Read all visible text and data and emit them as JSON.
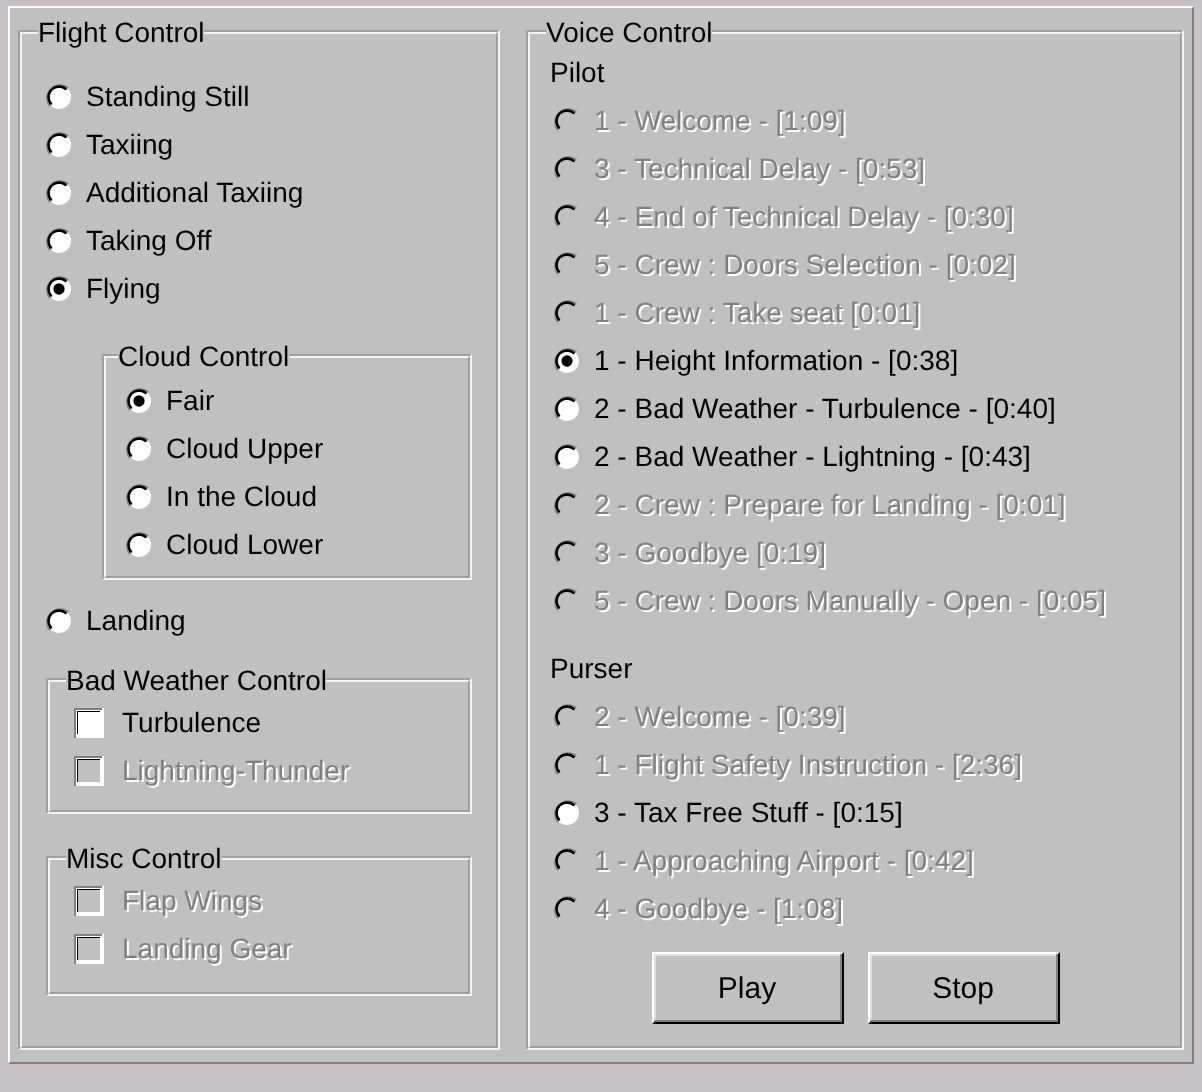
{
  "flight_control": {
    "title": "Flight Control",
    "modes": [
      {
        "label": "Standing Still",
        "selected": false
      },
      {
        "label": "Taxiing",
        "selected": false
      },
      {
        "label": "Additional Taxiing",
        "selected": false
      },
      {
        "label": "Taking Off",
        "selected": false
      },
      {
        "label": "Flying",
        "selected": true
      }
    ],
    "cloud_control": {
      "title": "Cloud Control",
      "options": [
        {
          "label": "Fair",
          "selected": true
        },
        {
          "label": "Cloud Upper",
          "selected": false
        },
        {
          "label": "In the Cloud",
          "selected": false
        },
        {
          "label": "Cloud Lower",
          "selected": false
        }
      ]
    },
    "landing": {
      "label": "Landing",
      "selected": false
    },
    "bad_weather_control": {
      "title": "Bad Weather Control",
      "options": [
        {
          "label": "Turbulence",
          "checked": false,
          "disabled": false
        },
        {
          "label": "Lightning-Thunder",
          "checked": false,
          "disabled": true
        }
      ]
    },
    "misc_control": {
      "title": "Misc Control",
      "options": [
        {
          "label": "Flap Wings",
          "checked": false,
          "disabled": true
        },
        {
          "label": "Landing Gear",
          "checked": false,
          "disabled": true
        }
      ]
    }
  },
  "voice_control": {
    "title": "Voice Control",
    "sections": [
      {
        "heading": "Pilot",
        "messages": [
          {
            "label": "1 - Welcome - [1:09]",
            "selected": false,
            "disabled": true
          },
          {
            "label": "3 - Technical Delay - [0:53]",
            "selected": false,
            "disabled": true
          },
          {
            "label": "4 - End of Technical Delay - [0:30]",
            "selected": false,
            "disabled": true
          },
          {
            "label": "5 - Crew : Doors Selection - [0:02]",
            "selected": false,
            "disabled": true
          },
          {
            "label": "1 - Crew : Take seat [0:01]",
            "selected": false,
            "disabled": true
          },
          {
            "label": "1 - Height Information - [0:38]",
            "selected": true,
            "disabled": false
          },
          {
            "label": "2 - Bad Weather - Turbulence - [0:40]",
            "selected": false,
            "disabled": false
          },
          {
            "label": "2 - Bad Weather - Lightning - [0:43]",
            "selected": false,
            "disabled": false
          },
          {
            "label": "2 - Crew : Prepare for Landing - [0:01]",
            "selected": false,
            "disabled": true
          },
          {
            "label": "3 - Goodbye [0:19]",
            "selected": false,
            "disabled": true
          },
          {
            "label": "5 - Crew : Doors Manually - Open - [0:05]",
            "selected": false,
            "disabled": true
          }
        ]
      },
      {
        "heading": "Purser",
        "messages": [
          {
            "label": "2 - Welcome - [0:39]",
            "selected": false,
            "disabled": true
          },
          {
            "label": "1 - Flight Safety Instruction - [2:36]",
            "selected": false,
            "disabled": true
          },
          {
            "label": "3 - Tax Free Stuff - [0:15]",
            "selected": false,
            "disabled": false
          },
          {
            "label": "1 - Approaching Airport - [0:42]",
            "selected": false,
            "disabled": true
          },
          {
            "label": "4 - Goodbye - [1:08]",
            "selected": false,
            "disabled": true
          }
        ]
      }
    ],
    "buttons": [
      "Play",
      "Stop"
    ]
  }
}
